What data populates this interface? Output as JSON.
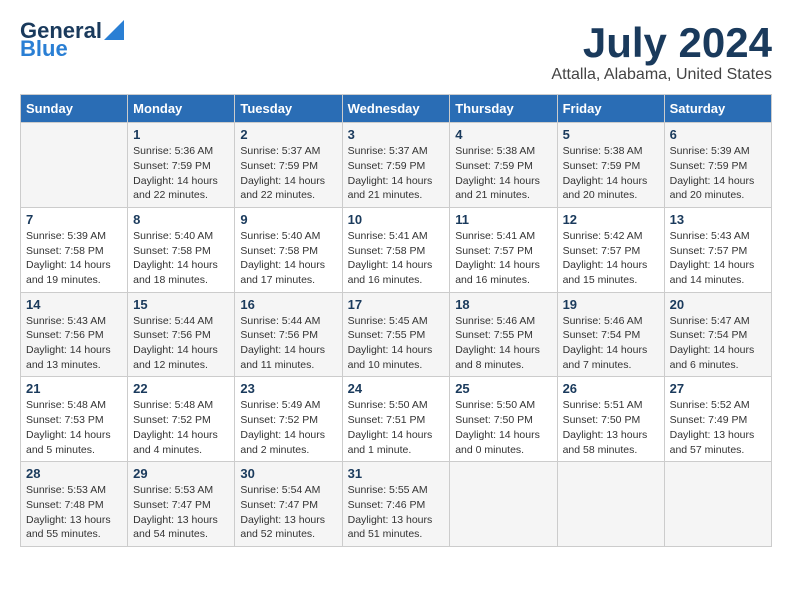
{
  "logo": {
    "line1": "General",
    "line2": "Blue"
  },
  "title": "July 2024",
  "location": "Attalla, Alabama, United States",
  "days_header": [
    "Sunday",
    "Monday",
    "Tuesday",
    "Wednesday",
    "Thursday",
    "Friday",
    "Saturday"
  ],
  "weeks": [
    [
      {
        "day": "",
        "info": ""
      },
      {
        "day": "1",
        "info": "Sunrise: 5:36 AM\nSunset: 7:59 PM\nDaylight: 14 hours\nand 22 minutes."
      },
      {
        "day": "2",
        "info": "Sunrise: 5:37 AM\nSunset: 7:59 PM\nDaylight: 14 hours\nand 22 minutes."
      },
      {
        "day": "3",
        "info": "Sunrise: 5:37 AM\nSunset: 7:59 PM\nDaylight: 14 hours\nand 21 minutes."
      },
      {
        "day": "4",
        "info": "Sunrise: 5:38 AM\nSunset: 7:59 PM\nDaylight: 14 hours\nand 21 minutes."
      },
      {
        "day": "5",
        "info": "Sunrise: 5:38 AM\nSunset: 7:59 PM\nDaylight: 14 hours\nand 20 minutes."
      },
      {
        "day": "6",
        "info": "Sunrise: 5:39 AM\nSunset: 7:59 PM\nDaylight: 14 hours\nand 20 minutes."
      }
    ],
    [
      {
        "day": "7",
        "info": "Sunrise: 5:39 AM\nSunset: 7:58 PM\nDaylight: 14 hours\nand 19 minutes."
      },
      {
        "day": "8",
        "info": "Sunrise: 5:40 AM\nSunset: 7:58 PM\nDaylight: 14 hours\nand 18 minutes."
      },
      {
        "day": "9",
        "info": "Sunrise: 5:40 AM\nSunset: 7:58 PM\nDaylight: 14 hours\nand 17 minutes."
      },
      {
        "day": "10",
        "info": "Sunrise: 5:41 AM\nSunset: 7:58 PM\nDaylight: 14 hours\nand 16 minutes."
      },
      {
        "day": "11",
        "info": "Sunrise: 5:41 AM\nSunset: 7:57 PM\nDaylight: 14 hours\nand 16 minutes."
      },
      {
        "day": "12",
        "info": "Sunrise: 5:42 AM\nSunset: 7:57 PM\nDaylight: 14 hours\nand 15 minutes."
      },
      {
        "day": "13",
        "info": "Sunrise: 5:43 AM\nSunset: 7:57 PM\nDaylight: 14 hours\nand 14 minutes."
      }
    ],
    [
      {
        "day": "14",
        "info": "Sunrise: 5:43 AM\nSunset: 7:56 PM\nDaylight: 14 hours\nand 13 minutes."
      },
      {
        "day": "15",
        "info": "Sunrise: 5:44 AM\nSunset: 7:56 PM\nDaylight: 14 hours\nand 12 minutes."
      },
      {
        "day": "16",
        "info": "Sunrise: 5:44 AM\nSunset: 7:56 PM\nDaylight: 14 hours\nand 11 minutes."
      },
      {
        "day": "17",
        "info": "Sunrise: 5:45 AM\nSunset: 7:55 PM\nDaylight: 14 hours\nand 10 minutes."
      },
      {
        "day": "18",
        "info": "Sunrise: 5:46 AM\nSunset: 7:55 PM\nDaylight: 14 hours\nand 8 minutes."
      },
      {
        "day": "19",
        "info": "Sunrise: 5:46 AM\nSunset: 7:54 PM\nDaylight: 14 hours\nand 7 minutes."
      },
      {
        "day": "20",
        "info": "Sunrise: 5:47 AM\nSunset: 7:54 PM\nDaylight: 14 hours\nand 6 minutes."
      }
    ],
    [
      {
        "day": "21",
        "info": "Sunrise: 5:48 AM\nSunset: 7:53 PM\nDaylight: 14 hours\nand 5 minutes."
      },
      {
        "day": "22",
        "info": "Sunrise: 5:48 AM\nSunset: 7:52 PM\nDaylight: 14 hours\nand 4 minutes."
      },
      {
        "day": "23",
        "info": "Sunrise: 5:49 AM\nSunset: 7:52 PM\nDaylight: 14 hours\nand 2 minutes."
      },
      {
        "day": "24",
        "info": "Sunrise: 5:50 AM\nSunset: 7:51 PM\nDaylight: 14 hours\nand 1 minute."
      },
      {
        "day": "25",
        "info": "Sunrise: 5:50 AM\nSunset: 7:50 PM\nDaylight: 14 hours\nand 0 minutes."
      },
      {
        "day": "26",
        "info": "Sunrise: 5:51 AM\nSunset: 7:50 PM\nDaylight: 13 hours\nand 58 minutes."
      },
      {
        "day": "27",
        "info": "Sunrise: 5:52 AM\nSunset: 7:49 PM\nDaylight: 13 hours\nand 57 minutes."
      }
    ],
    [
      {
        "day": "28",
        "info": "Sunrise: 5:53 AM\nSunset: 7:48 PM\nDaylight: 13 hours\nand 55 minutes."
      },
      {
        "day": "29",
        "info": "Sunrise: 5:53 AM\nSunset: 7:47 PM\nDaylight: 13 hours\nand 54 minutes."
      },
      {
        "day": "30",
        "info": "Sunrise: 5:54 AM\nSunset: 7:47 PM\nDaylight: 13 hours\nand 52 minutes."
      },
      {
        "day": "31",
        "info": "Sunrise: 5:55 AM\nSunset: 7:46 PM\nDaylight: 13 hours\nand 51 minutes."
      },
      {
        "day": "",
        "info": ""
      },
      {
        "day": "",
        "info": ""
      },
      {
        "day": "",
        "info": ""
      }
    ]
  ]
}
